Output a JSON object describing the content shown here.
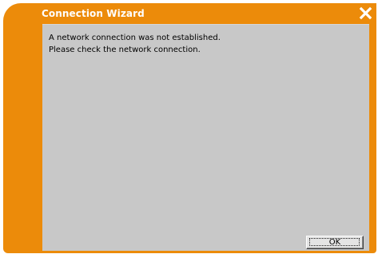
{
  "window": {
    "title": "Connection Wizard",
    "close_icon": "close-icon",
    "accent_color": "#ec8b0a",
    "content_background": "#c8c8c8"
  },
  "message": {
    "line1": "A network connection was not established.",
    "line2": "Please check the network connection."
  },
  "buttons": {
    "ok_label": "OK"
  }
}
